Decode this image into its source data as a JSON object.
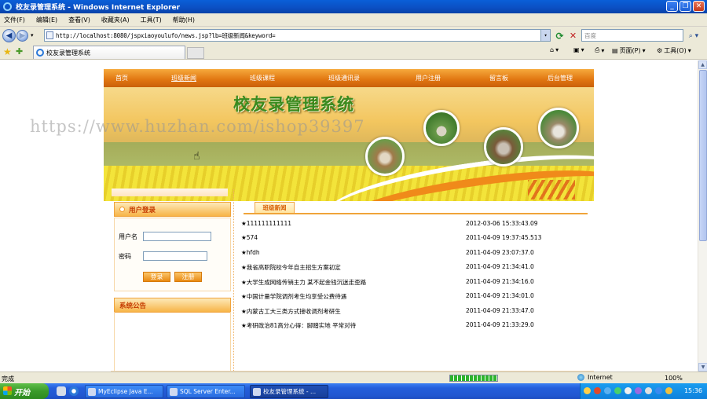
{
  "window": {
    "title": "校友录管理系统 - Windows Internet Explorer"
  },
  "menu": [
    "文件(F)",
    "编辑(E)",
    "查看(V)",
    "收藏夹(A)",
    "工具(T)",
    "帮助(H)"
  ],
  "address": {
    "url": "http://localhost:8080/jspxiaoyoulufo/news.jsp?lb=班级新闻&keyword=",
    "search_placeholder": "百度"
  },
  "tab": {
    "label": "校友录管理系统"
  },
  "commands": {
    "page": "页面(P)",
    "tools": "工具(O)"
  },
  "site": {
    "nav": [
      "首页",
      "班级新闻",
      "班级课程",
      "班级通讯录",
      "用户注册",
      "留言板",
      "后台管理"
    ],
    "banner_title": "校友录管理系统",
    "watermark": "https://www.huzhan.com/ishop39397",
    "login": {
      "title": "用户登录",
      "username_label": "用户名",
      "password_label": "密码",
      "login_button": "登录",
      "register_button": "注册"
    },
    "notice": {
      "title": "系统公告"
    },
    "news": {
      "tab_label": "班级新闻",
      "items": [
        {
          "title": "★111111111111",
          "date": "2012-03-06 15:33:43.09"
        },
        {
          "title": "★574",
          "date": "2011-04-09 19:37:45.513"
        },
        {
          "title": "★hfdh",
          "date": "2011-04-09 23:07:37.0"
        },
        {
          "title": "★我省高职院校今年自主招生方案初定",
          "date": "2011-04-09 21:34:41.0"
        },
        {
          "title": "★大学生成网络传销主力 某不起金钱沉迷走歪路",
          "date": "2011-04-09 21:34:16.0"
        },
        {
          "title": "★中国计量学院调剂考生均享受公费待遇",
          "date": "2011-04-09 21:34:01.0"
        },
        {
          "title": "★内蒙古工大三类方式接收调剂考研生",
          "date": "2011-04-09 21:33:47.0"
        },
        {
          "title": "★考研政治81高分心得：脚踏实地 平常对待",
          "date": "2011-04-09 21:33:29.0"
        }
      ]
    }
  },
  "status": {
    "text": "完成",
    "zone": "Internet",
    "zoom": "100%"
  },
  "taskbar": {
    "start": "开始",
    "tasks": [
      "MyEclipse Java E...",
      "SQL Server Enter...",
      "校友录管理系统 - ..."
    ],
    "clock": "15:36"
  }
}
